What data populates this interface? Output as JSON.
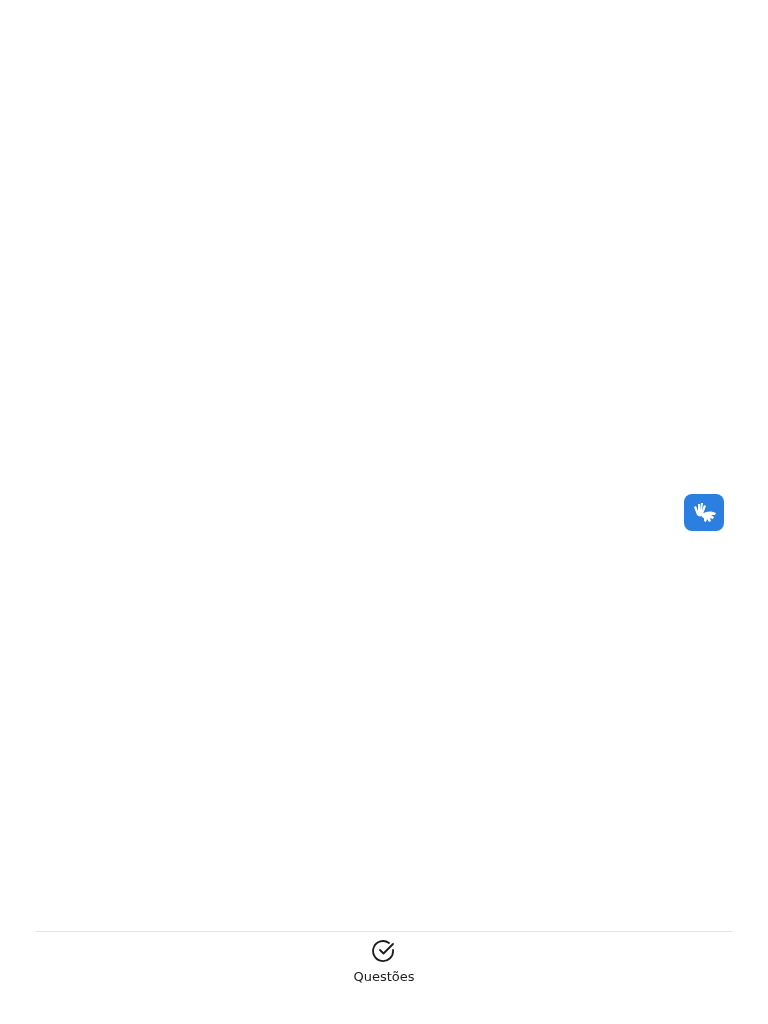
{
  "tab_bar": {
    "tabs": [
      {
        "label": "Questões",
        "selected": true
      }
    ]
  }
}
